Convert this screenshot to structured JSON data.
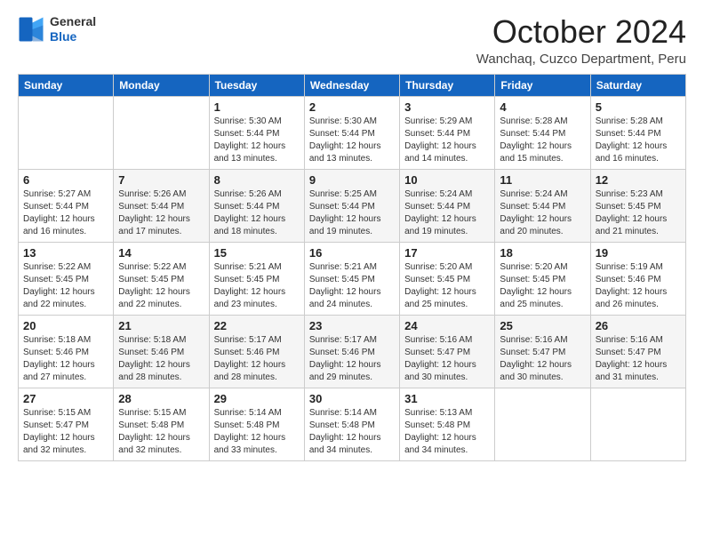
{
  "logo": {
    "general": "General",
    "blue": "Blue"
  },
  "header": {
    "title": "October 2024",
    "subtitle": "Wanchaq, Cuzco Department, Peru"
  },
  "days_of_week": [
    "Sunday",
    "Monday",
    "Tuesday",
    "Wednesday",
    "Thursday",
    "Friday",
    "Saturday"
  ],
  "weeks": [
    [
      {
        "day": "",
        "info": ""
      },
      {
        "day": "",
        "info": ""
      },
      {
        "day": "1",
        "info": "Sunrise: 5:30 AM\nSunset: 5:44 PM\nDaylight: 12 hours and 13 minutes."
      },
      {
        "day": "2",
        "info": "Sunrise: 5:30 AM\nSunset: 5:44 PM\nDaylight: 12 hours and 13 minutes."
      },
      {
        "day": "3",
        "info": "Sunrise: 5:29 AM\nSunset: 5:44 PM\nDaylight: 12 hours and 14 minutes."
      },
      {
        "day": "4",
        "info": "Sunrise: 5:28 AM\nSunset: 5:44 PM\nDaylight: 12 hours and 15 minutes."
      },
      {
        "day": "5",
        "info": "Sunrise: 5:28 AM\nSunset: 5:44 PM\nDaylight: 12 hours and 16 minutes."
      }
    ],
    [
      {
        "day": "6",
        "info": "Sunrise: 5:27 AM\nSunset: 5:44 PM\nDaylight: 12 hours and 16 minutes."
      },
      {
        "day": "7",
        "info": "Sunrise: 5:26 AM\nSunset: 5:44 PM\nDaylight: 12 hours and 17 minutes."
      },
      {
        "day": "8",
        "info": "Sunrise: 5:26 AM\nSunset: 5:44 PM\nDaylight: 12 hours and 18 minutes."
      },
      {
        "day": "9",
        "info": "Sunrise: 5:25 AM\nSunset: 5:44 PM\nDaylight: 12 hours and 19 minutes."
      },
      {
        "day": "10",
        "info": "Sunrise: 5:24 AM\nSunset: 5:44 PM\nDaylight: 12 hours and 19 minutes."
      },
      {
        "day": "11",
        "info": "Sunrise: 5:24 AM\nSunset: 5:44 PM\nDaylight: 12 hours and 20 minutes."
      },
      {
        "day": "12",
        "info": "Sunrise: 5:23 AM\nSunset: 5:45 PM\nDaylight: 12 hours and 21 minutes."
      }
    ],
    [
      {
        "day": "13",
        "info": "Sunrise: 5:22 AM\nSunset: 5:45 PM\nDaylight: 12 hours and 22 minutes."
      },
      {
        "day": "14",
        "info": "Sunrise: 5:22 AM\nSunset: 5:45 PM\nDaylight: 12 hours and 22 minutes."
      },
      {
        "day": "15",
        "info": "Sunrise: 5:21 AM\nSunset: 5:45 PM\nDaylight: 12 hours and 23 minutes."
      },
      {
        "day": "16",
        "info": "Sunrise: 5:21 AM\nSunset: 5:45 PM\nDaylight: 12 hours and 24 minutes."
      },
      {
        "day": "17",
        "info": "Sunrise: 5:20 AM\nSunset: 5:45 PM\nDaylight: 12 hours and 25 minutes."
      },
      {
        "day": "18",
        "info": "Sunrise: 5:20 AM\nSunset: 5:45 PM\nDaylight: 12 hours and 25 minutes."
      },
      {
        "day": "19",
        "info": "Sunrise: 5:19 AM\nSunset: 5:46 PM\nDaylight: 12 hours and 26 minutes."
      }
    ],
    [
      {
        "day": "20",
        "info": "Sunrise: 5:18 AM\nSunset: 5:46 PM\nDaylight: 12 hours and 27 minutes."
      },
      {
        "day": "21",
        "info": "Sunrise: 5:18 AM\nSunset: 5:46 PM\nDaylight: 12 hours and 28 minutes."
      },
      {
        "day": "22",
        "info": "Sunrise: 5:17 AM\nSunset: 5:46 PM\nDaylight: 12 hours and 28 minutes."
      },
      {
        "day": "23",
        "info": "Sunrise: 5:17 AM\nSunset: 5:46 PM\nDaylight: 12 hours and 29 minutes."
      },
      {
        "day": "24",
        "info": "Sunrise: 5:16 AM\nSunset: 5:47 PM\nDaylight: 12 hours and 30 minutes."
      },
      {
        "day": "25",
        "info": "Sunrise: 5:16 AM\nSunset: 5:47 PM\nDaylight: 12 hours and 30 minutes."
      },
      {
        "day": "26",
        "info": "Sunrise: 5:16 AM\nSunset: 5:47 PM\nDaylight: 12 hours and 31 minutes."
      }
    ],
    [
      {
        "day": "27",
        "info": "Sunrise: 5:15 AM\nSunset: 5:47 PM\nDaylight: 12 hours and 32 minutes."
      },
      {
        "day": "28",
        "info": "Sunrise: 5:15 AM\nSunset: 5:48 PM\nDaylight: 12 hours and 32 minutes."
      },
      {
        "day": "29",
        "info": "Sunrise: 5:14 AM\nSunset: 5:48 PM\nDaylight: 12 hours and 33 minutes."
      },
      {
        "day": "30",
        "info": "Sunrise: 5:14 AM\nSunset: 5:48 PM\nDaylight: 12 hours and 34 minutes."
      },
      {
        "day": "31",
        "info": "Sunrise: 5:13 AM\nSunset: 5:48 PM\nDaylight: 12 hours and 34 minutes."
      },
      {
        "day": "",
        "info": ""
      },
      {
        "day": "",
        "info": ""
      }
    ]
  ]
}
